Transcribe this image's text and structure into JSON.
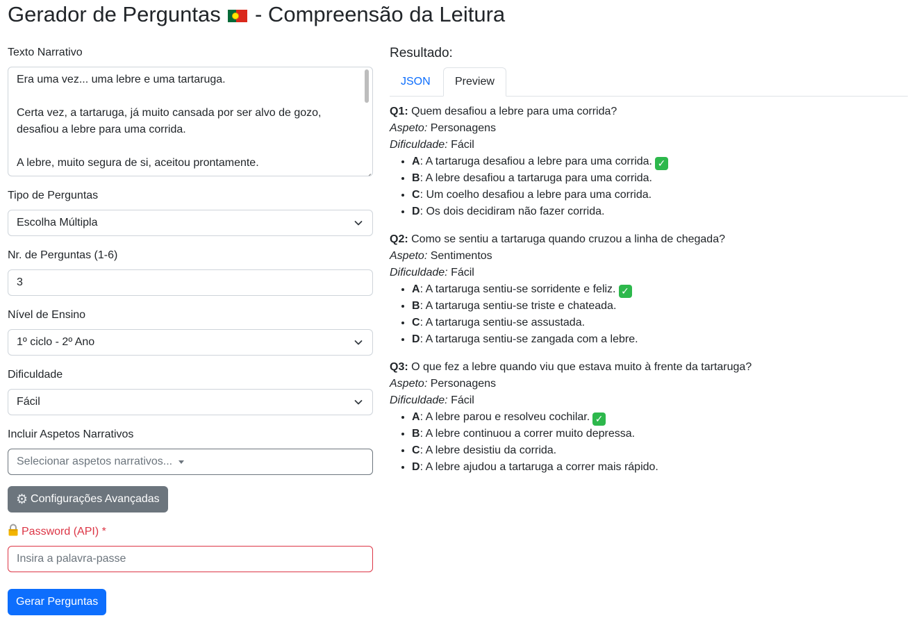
{
  "header": {
    "title_before": "Gerador de Perguntas",
    "title_after": "- Compreensão da Leitura",
    "flag_icon": "portugal-flag-icon"
  },
  "form": {
    "narrative_label": "Texto Narrativo",
    "narrative_text": "Era uma vez... uma lebre e uma tartaruga.\n\nCerta vez, a tartaruga, já muito cansada por ser alvo de gozo, desafiou a lebre para uma corrida.\n\nA lebre, muito segura de si, aceitou prontamente.",
    "question_type_label": "Tipo de Perguntas",
    "question_type_value": "Escolha Múltipla",
    "num_questions_label": "Nr. de Perguntas (1-6)",
    "num_questions_value": "3",
    "level_label": "Nível de Ensino",
    "level_value": "1º ciclo - 2º Ano",
    "difficulty_label": "Dificuldade",
    "difficulty_value": "Fácil",
    "aspects_label": "Incluir Aspetos Narrativos",
    "aspects_placeholder": "Selecionar aspetos narrativos...",
    "advanced_button": "Configurações Avançadas",
    "password_label": "Password (API) *",
    "password_placeholder": "Insira a palavra-passe",
    "submit_button": "Gerar Perguntas"
  },
  "result": {
    "title": "Resultado:",
    "tabs": [
      "JSON",
      "Preview"
    ],
    "active_tab": "Preview",
    "aspect_label": "Aspeto:",
    "difficulty_label": "Dificuldade:",
    "questions": [
      {
        "id": "Q1:",
        "text": "Quem desafiou a lebre para uma corrida?",
        "aspect": "Personagens",
        "difficulty": "Fácil",
        "options": [
          {
            "key": "A",
            "text": ": A tartaruga desafiou a lebre para uma corrida.",
            "correct": true
          },
          {
            "key": "B",
            "text": ": A lebre desafiou a tartaruga para uma corrida.",
            "correct": false
          },
          {
            "key": "C",
            "text": ": Um coelho desafiou a lebre para uma corrida.",
            "correct": false
          },
          {
            "key": "D",
            "text": ": Os dois decidiram não fazer corrida.",
            "correct": false
          }
        ]
      },
      {
        "id": "Q2:",
        "text": "Como se sentiu a tartaruga quando cruzou a linha de chegada?",
        "aspect": "Sentimentos",
        "difficulty": "Fácil",
        "options": [
          {
            "key": "A",
            "text": ": A tartaruga sentiu-se sorridente e feliz.",
            "correct": true
          },
          {
            "key": "B",
            "text": ": A tartaruga sentiu-se triste e chateada.",
            "correct": false
          },
          {
            "key": "C",
            "text": ": A tartaruga sentiu-se assustada.",
            "correct": false
          },
          {
            "key": "D",
            "text": ": A tartaruga sentiu-se zangada com a lebre.",
            "correct": false
          }
        ]
      },
      {
        "id": "Q3:",
        "text": "O que fez a lebre quando viu que estava muito à frente da tartaruga?",
        "aspect": "Personagens",
        "difficulty": "Fácil",
        "options": [
          {
            "key": "A",
            "text": ": A lebre parou e resolveu cochilar.",
            "correct": true
          },
          {
            "key": "B",
            "text": ": A lebre continuou a correr muito depressa.",
            "correct": false
          },
          {
            "key": "C",
            "text": ": A lebre desistiu da corrida.",
            "correct": false
          },
          {
            "key": "D",
            "text": ": A lebre ajudou a tartaruga a correr mais rápido.",
            "correct": false
          }
        ]
      }
    ]
  },
  "colors": {
    "primary": "#0d6efd",
    "secondary": "#6c757d",
    "danger": "#dc3545",
    "check": "#2db84c"
  }
}
